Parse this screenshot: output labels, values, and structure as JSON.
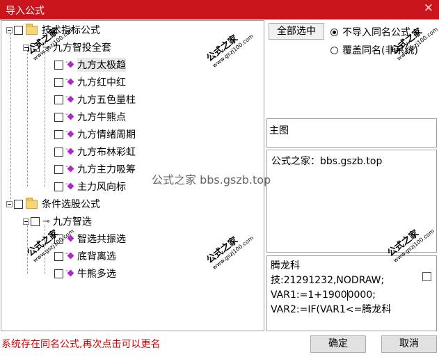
{
  "window": {
    "title": "导入公式",
    "close_glyph": "✕"
  },
  "tree": {
    "nodes": [
      {
        "label": "技术指标公式",
        "kind": "folder"
      },
      {
        "label": "九方智投全套",
        "kind": "key"
      },
      {
        "label": "九方太极趋",
        "kind": "formula",
        "selected": true
      },
      {
        "label": "九方红中红",
        "kind": "formula"
      },
      {
        "label": "九方五色量柱",
        "kind": "formula"
      },
      {
        "label": "九方牛熊点",
        "kind": "formula"
      },
      {
        "label": "九方情绪周期",
        "kind": "formula"
      },
      {
        "label": "九方布林彩虹",
        "kind": "formula"
      },
      {
        "label": "九方主力吸筹",
        "kind": "formula"
      },
      {
        "label": "主力风向标",
        "kind": "formula"
      },
      {
        "label": "条件选股公式",
        "kind": "folder"
      },
      {
        "label": "九方智选",
        "kind": "key"
      },
      {
        "label": "智选共振选",
        "kind": "formula"
      },
      {
        "label": "底背离选",
        "kind": "formula"
      },
      {
        "label": "牛熊多选",
        "kind": "formula"
      }
    ]
  },
  "options": {
    "select_all_label": "全部选中",
    "radio_no_import_label": "不导入同名公式",
    "radio_overwrite_label": "覆盖同名(非系统)",
    "radio_selected": "no_import"
  },
  "main_chart": {
    "label": "主图"
  },
  "description": {
    "text": "公式之家：bbs.gszb.top"
  },
  "code": {
    "lines": [
      "腾龙科",
      "技:21291232,NODRAW;",
      "VAR1:=1+1900",
      "0000;",
      "VAR2:=IF(VAR1<=腾龙科"
    ]
  },
  "status": {
    "message": "系统存在同名公式,再次点击可以更名"
  },
  "footer": {
    "ok_label": "确定",
    "cancel_label": "取消"
  },
  "watermarks": {
    "center": "公式之家 bbs.gszb.top",
    "stamp_big": "公式之家",
    "stamp_small": "www.gszj100.com"
  },
  "colors": {
    "titlebar": "#c8141a",
    "status_text": "#d60000",
    "formula_icon": "#b326c9"
  }
}
